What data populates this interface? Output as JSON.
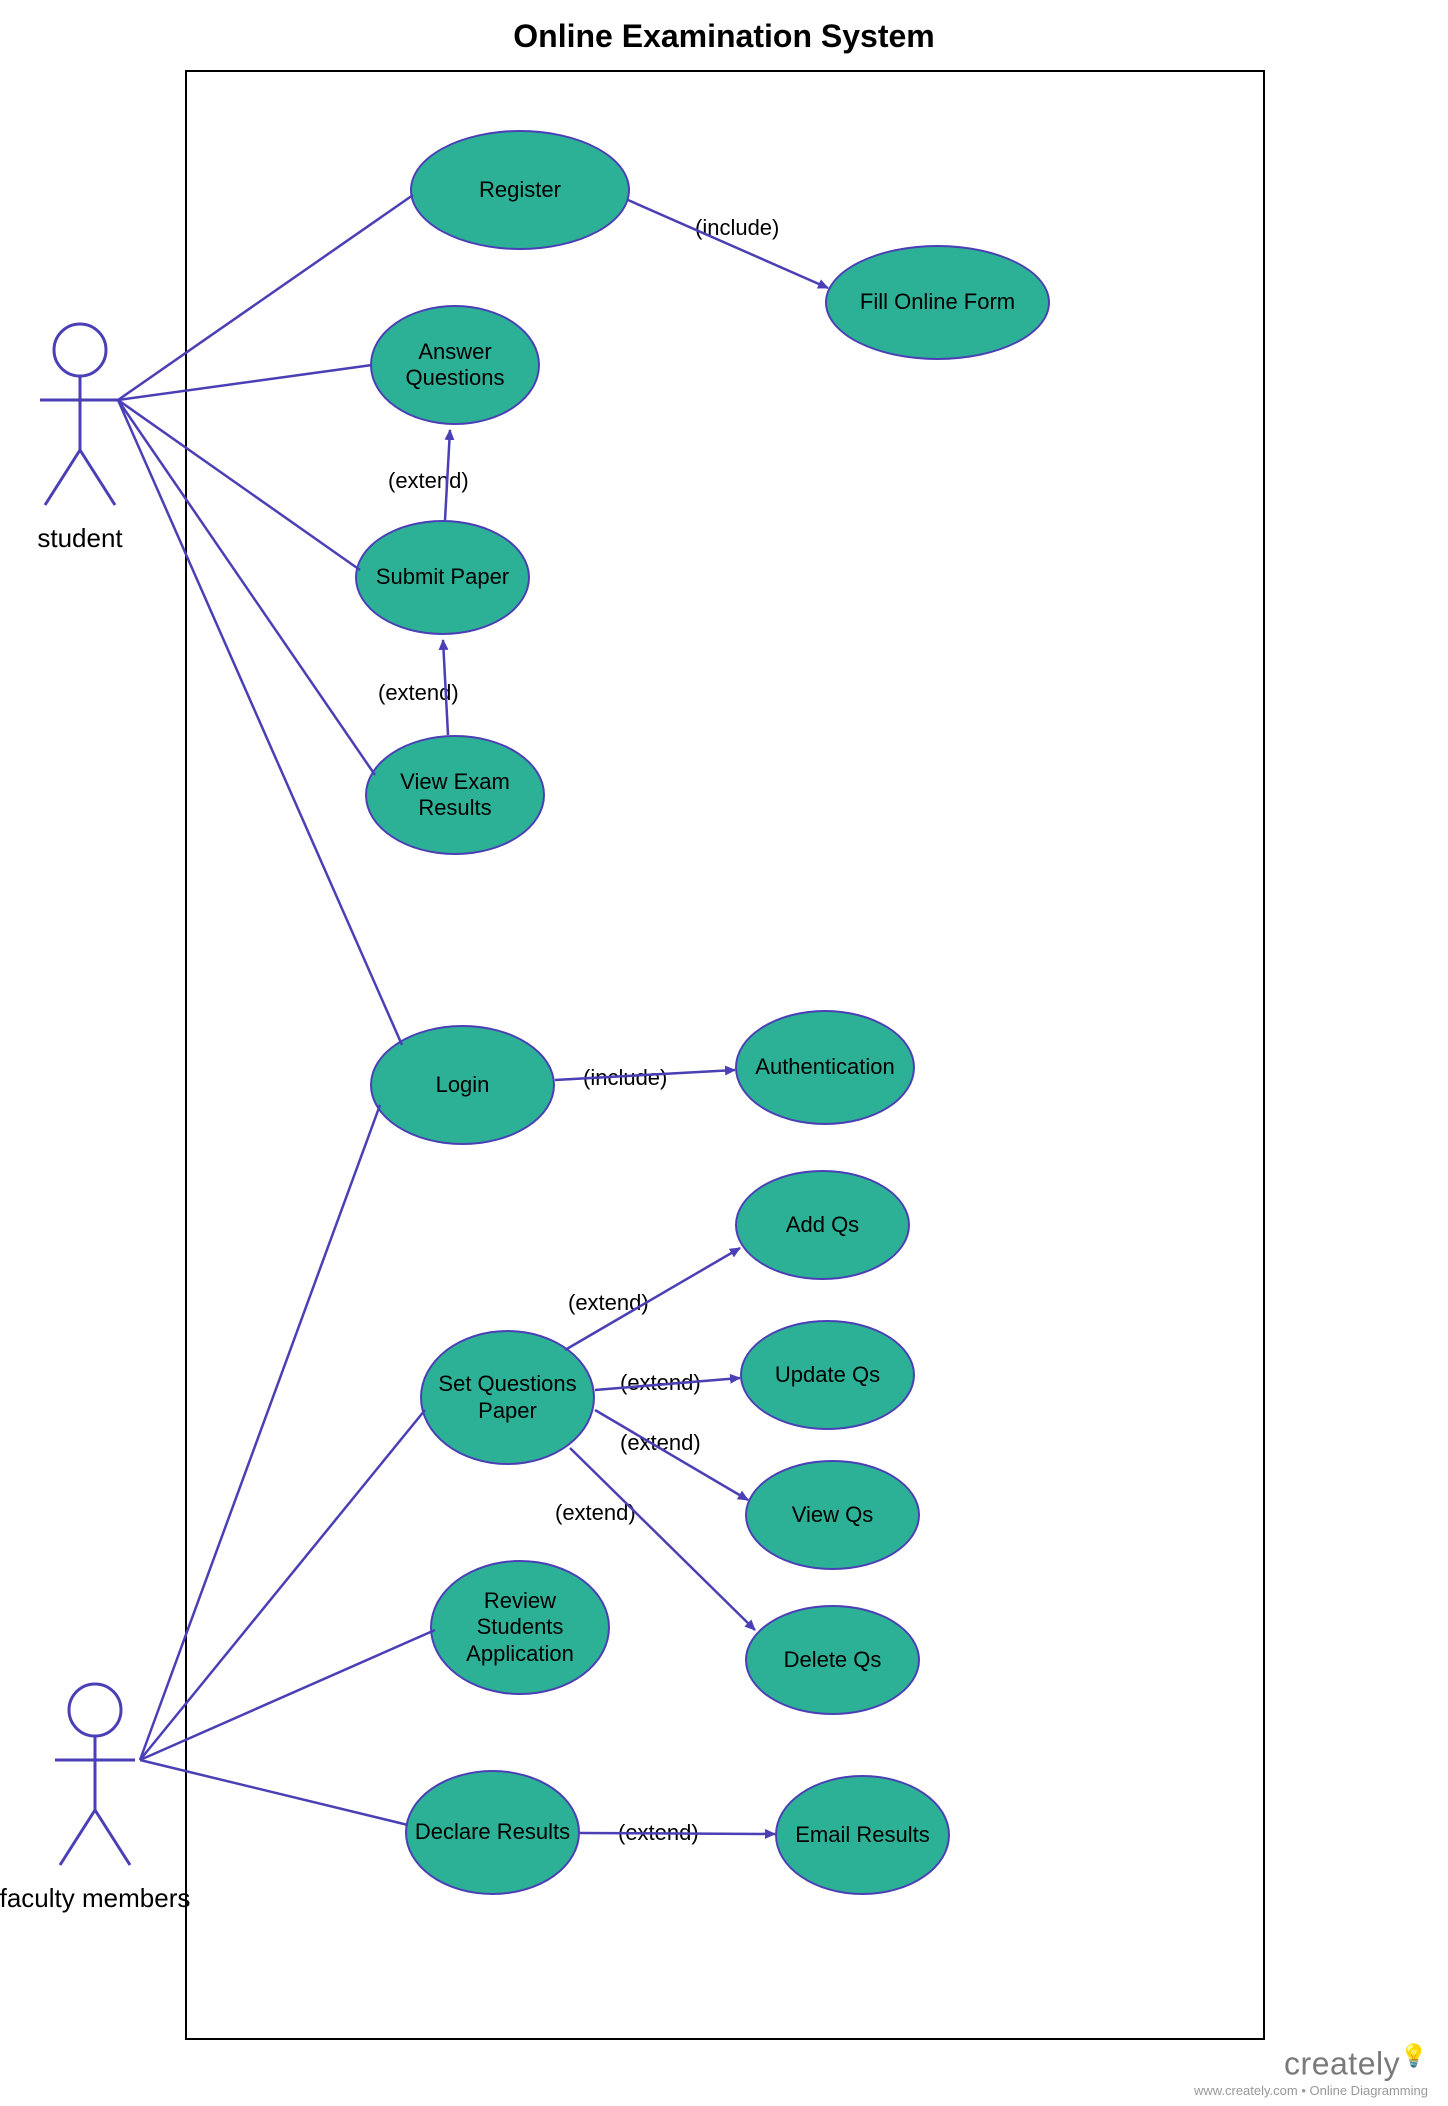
{
  "title": "Online Examination System",
  "actors": {
    "student": {
      "label": "student"
    },
    "faculty": {
      "label": "faculty members"
    }
  },
  "usecases": {
    "register": {
      "label": "Register"
    },
    "fill_form": {
      "label": "Fill Online Form"
    },
    "answer_q": {
      "label": "Answer Questions"
    },
    "submit_paper": {
      "label": "Submit Paper"
    },
    "view_results": {
      "label": "View Exam Results"
    },
    "login": {
      "label": "Login"
    },
    "auth": {
      "label": "Authentication"
    },
    "set_qp": {
      "label": "Set Questions Paper"
    },
    "add_qs": {
      "label": "Add Qs"
    },
    "update_qs": {
      "label": "Update Qs"
    },
    "view_qs": {
      "label": "View Qs"
    },
    "delete_qs": {
      "label": "Delete Qs"
    },
    "review_app": {
      "label": "Review Students Application"
    },
    "declare": {
      "label": "Declare Results"
    },
    "email_res": {
      "label": "Email Results"
    }
  },
  "relations": {
    "include": "(include)",
    "extend": "(extend)"
  },
  "watermark": {
    "brand": "creately",
    "sub": "www.creately.com • Online Diagramming"
  },
  "colors": {
    "usecase_fill": "#2db196",
    "usecase_stroke": "#4a3fb5",
    "connector": "#4a3fb5"
  }
}
